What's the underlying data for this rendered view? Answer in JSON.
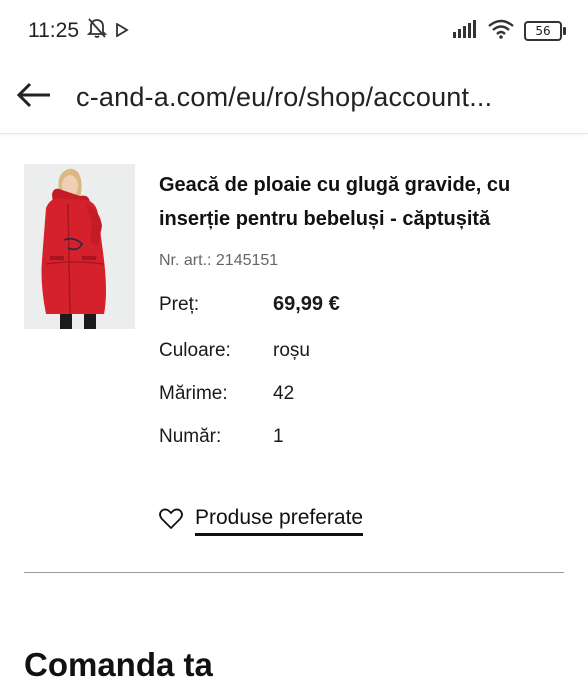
{
  "status_bar": {
    "time": "11:25",
    "battery": "56"
  },
  "url_bar": {
    "url": "c-and-a.com/eu/ro/shop/account..."
  },
  "product": {
    "title": "Geacă de ploaie cu glugă gravide, cu inserție pentru bebeluși - căptușită",
    "article_number": "Nr. art.: 2145151",
    "attributes": [
      {
        "label": "Preț:",
        "value": "69,99 €"
      },
      {
        "label": "Culoare:",
        "value": "roșu"
      },
      {
        "label": "Mărime:",
        "value": "42"
      },
      {
        "label": "Număr:",
        "value": "1"
      }
    ],
    "favorites_label": "Produse preferate"
  },
  "section": {
    "title": "Comanda ta"
  },
  "colors": {
    "product_red": "#d4212c",
    "text": "#111111",
    "muted": "#666666"
  }
}
